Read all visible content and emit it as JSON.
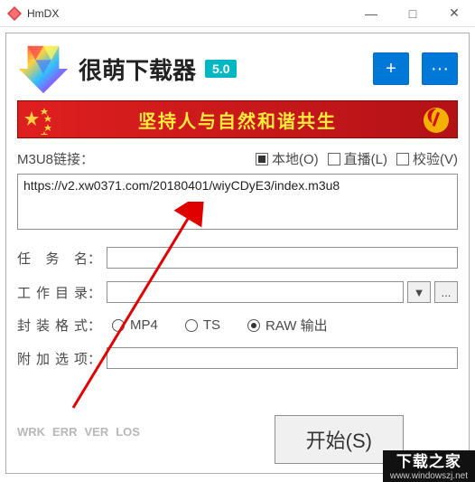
{
  "window": {
    "title": "HmDX",
    "minimize": "—",
    "maximize": "□",
    "close": "✕"
  },
  "header": {
    "app_name": "很萌下载器",
    "version": "5.0",
    "add_btn": "+",
    "more_btn": "···"
  },
  "banner": {
    "text": "坚持人与自然和谐共生"
  },
  "m3u8": {
    "label": "M3U8链接：",
    "local": "本地(O)",
    "live": "直播(L)",
    "verify": "校验(V)",
    "local_checked": true,
    "live_checked": false,
    "verify_checked": false,
    "url": "https://v2.xw0371.com/20180401/wiyCDyE3/index.m3u8"
  },
  "fields": {
    "task_label": "任务名",
    "task_value": "",
    "dir_label": "工作目录",
    "dir_value": "",
    "dir_dropdown": "▼",
    "dir_browse": "...",
    "format_label": "封装格式",
    "opt_label": "附加选项",
    "opt_value": ""
  },
  "format": {
    "mp4": "MP4",
    "ts": "TS",
    "raw": "RAW 输出",
    "selected": "raw"
  },
  "status": {
    "wrk": "WRK",
    "err": "ERR",
    "ver": "VER",
    "los": "LOS"
  },
  "start_btn": "开始(S)",
  "watermark": {
    "line1": "下载之家",
    "line2": "www.windowszj.net"
  }
}
